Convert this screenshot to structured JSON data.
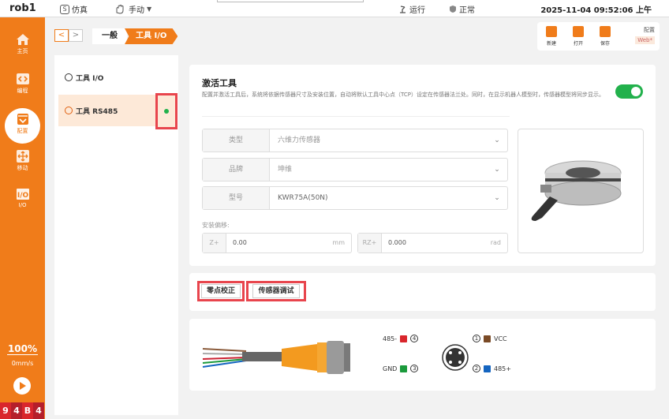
{
  "topbar": {
    "robot_name": "rob1",
    "sim_label": "仿真",
    "manual_label": "手动",
    "run_label": "运行",
    "normal_label": "正常",
    "datetime": "2025-11-04 09:52:06 上午"
  },
  "sidebar": {
    "items": [
      {
        "label": "主页",
        "icon": "home-icon"
      },
      {
        "label": "编程",
        "icon": "code-icon"
      },
      {
        "label": "配置",
        "icon": "config-icon"
      },
      {
        "label": "移动",
        "icon": "move-icon"
      },
      {
        "label": "I/O",
        "icon": "io-icon"
      }
    ],
    "active_index": 2,
    "speed_percent": "100%",
    "speed_unit": "0mm/s",
    "badges": [
      "9",
      "4",
      "B",
      "4"
    ]
  },
  "breadcrumb": {
    "level1": "一般",
    "level2": "工具 I/O"
  },
  "toolbar": {
    "new_label": "新建",
    "open_label": "打开",
    "save_label": "保存",
    "config_label": "配置",
    "web_label": "Web*"
  },
  "left_list": {
    "items": [
      {
        "label": "工具 I/O"
      },
      {
        "label": "工具 RS485"
      }
    ],
    "selected_index": 1
  },
  "activate_tool": {
    "title": "激活工具",
    "description": "配置并激活工具后，系统将依据传感器尺寸及安装位置，自动将默认工具中心点（TCP）设定在传感器法兰处。同时，在显示机器人模型时，传感器模型将同步显示。",
    "enabled": true
  },
  "sensor_form": {
    "type_label": "类型",
    "type_value": "六维力传感器",
    "brand_label": "品牌",
    "brand_value": "坤维",
    "model_label": "型号",
    "model_value": "KWR75A(50N)",
    "offset_label": "安装偏移:",
    "z_label": "Z+",
    "z_value": "0.00",
    "z_unit": "mm",
    "rz_label": "RZ+",
    "rz_value": "0.000",
    "rz_unit": "rad"
  },
  "actions": {
    "zero_button": "零点校正",
    "debug_button": "传感器调试"
  },
  "wiring": {
    "pins": [
      {
        "name": "485-",
        "num": "4",
        "color": "#d9262c"
      },
      {
        "name": "VCC",
        "num": "1",
        "color": "#7a4a26"
      },
      {
        "name": "GND",
        "num": "3",
        "color": "#1b9a3c"
      },
      {
        "name": "485+",
        "num": "2",
        "color": "#1565c0"
      }
    ]
  },
  "colors": {
    "accent": "#f07c1a",
    "highlight": "#e8454d",
    "toggle_on": "#22b14c"
  }
}
